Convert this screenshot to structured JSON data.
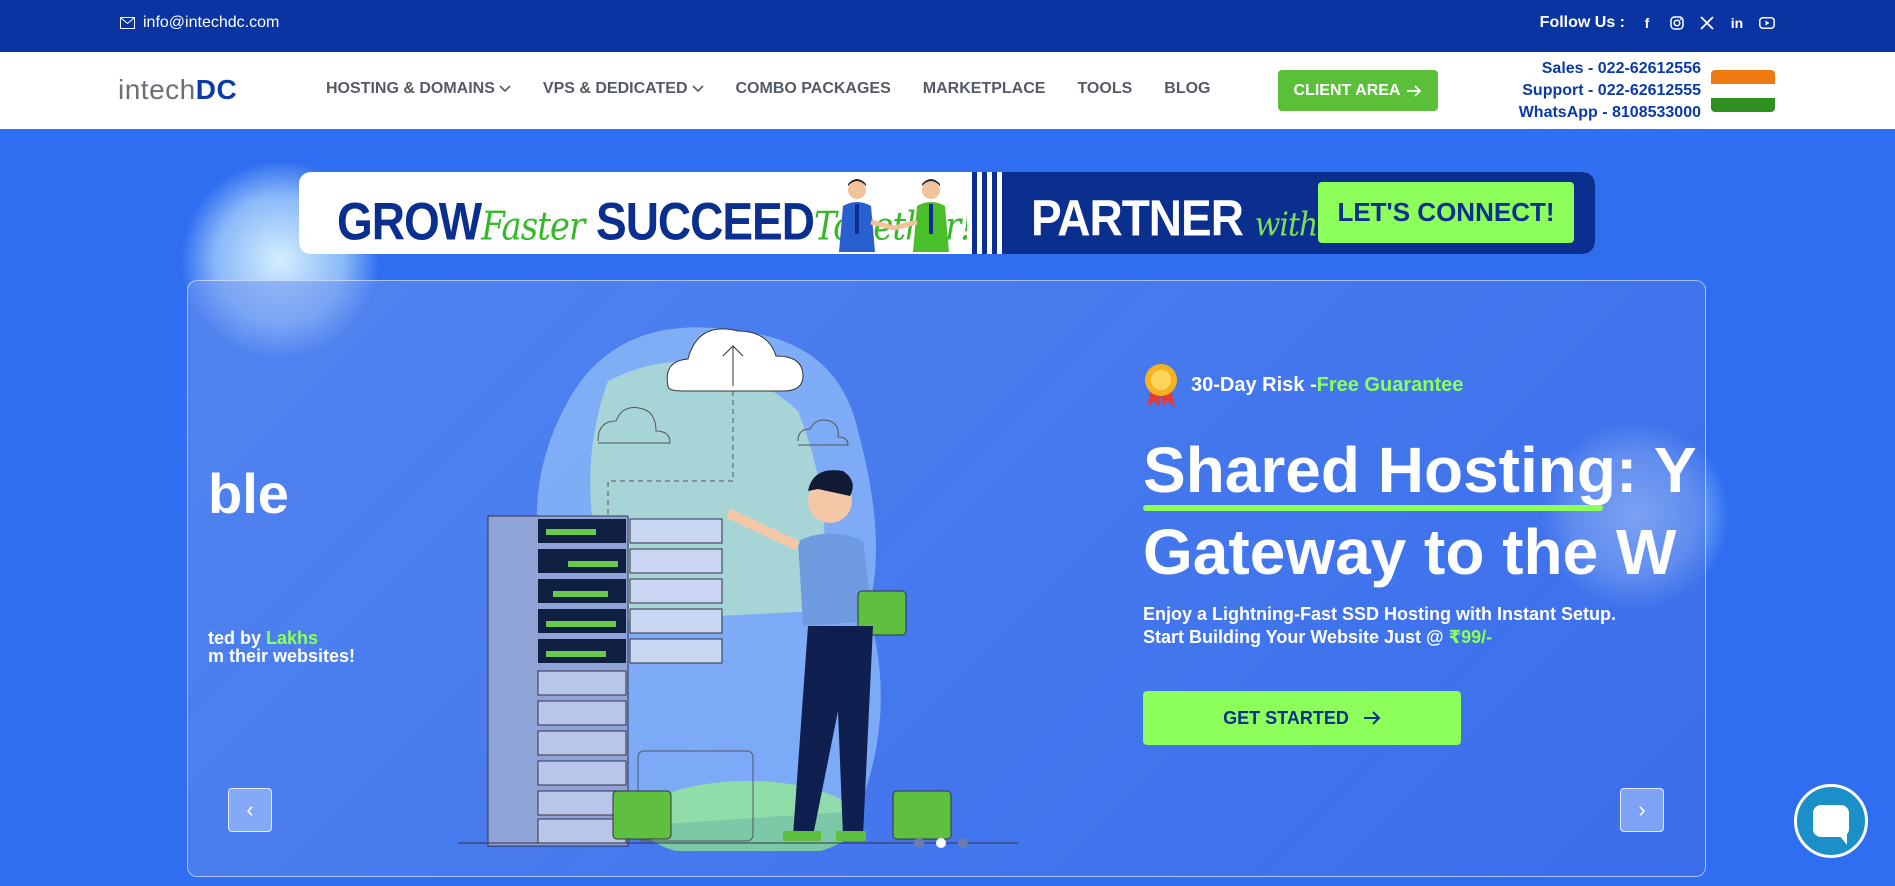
{
  "topbar": {
    "email": "info@intechdc.com",
    "follow_label": "Follow Us :",
    "social_icons": [
      "facebook-icon",
      "instagram-icon",
      "x-twitter-icon",
      "linkedin-icon",
      "youtube-icon"
    ]
  },
  "logo": {
    "text_main": "intech",
    "text_accent": "DC"
  },
  "nav": {
    "items": [
      {
        "label": "HOSTING & DOMAINS",
        "dropdown": true
      },
      {
        "label": "VPS & DEDICATED",
        "dropdown": true
      },
      {
        "label": "COMBO PACKAGES",
        "dropdown": false
      },
      {
        "label": "MARKETPLACE",
        "dropdown": false
      },
      {
        "label": "TOOLS",
        "dropdown": false
      },
      {
        "label": "BLOG",
        "dropdown": false
      }
    ],
    "client_area": "CLIENT AREA",
    "contacts": {
      "sales": "Sales - 022-62612556",
      "support": "Support - 022-62612555",
      "whatsapp": "WhatsApp - 8108533000"
    }
  },
  "banner": {
    "grow": "GROW",
    "faster": "Faster",
    "succeed": "SUCCEED",
    "together": "Together!",
    "partner": "PARTNER",
    "with_us": "with us",
    "connect": "LET'S CONNECT!"
  },
  "hero": {
    "prev_slide_partial_title": "ble",
    "prev_slide_line1_prefix": "ted by ",
    "prev_slide_line1_highlight": "Lakhs",
    "prev_slide_line2": "m their websites!",
    "guarantee_prefix": "30-Day Risk -",
    "guarantee_highlight": "Free Guarantee",
    "title_line1": "Shared Hosting: Y",
    "title_line2": "Gateway to the W",
    "subtitle_line1": "Enjoy a Lightning-Fast SSD Hosting with Instant Setup.",
    "subtitle_line2_prefix": "Start Building Your Website Just @ ",
    "subtitle_price": "₹99/-",
    "cta": "GET STARTED",
    "prev_arrow": "‹",
    "next_arrow": "›",
    "slides_total": 3,
    "slide_active_index": 1
  },
  "colors": {
    "topbar": "#0a34a2",
    "primary_blue": "#0a3aa8",
    "accent_green": "#8cff5a",
    "client_btn_green": "#5cbf3a",
    "hero_bg": "#2f6ef0"
  }
}
